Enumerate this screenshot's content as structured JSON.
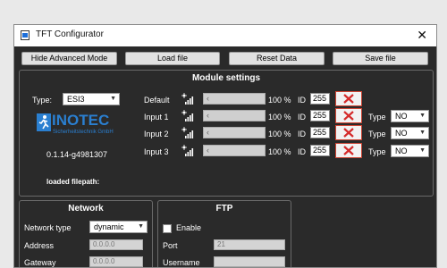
{
  "window": {
    "title": "TFT Configurator",
    "close": "✕"
  },
  "toolbar": {
    "hide_advanced": "Hide Advanced Mode",
    "load_file": "Load file",
    "reset_data": "Reset Data",
    "save_file": "Save file"
  },
  "module_settings": {
    "title": "Module settings",
    "type_label": "Type:",
    "type_value": "ESI3",
    "logo": {
      "word": "INOTEC",
      "sub": "Sicherheitstechnik GmbH"
    },
    "version": "0.1.14-g4981307",
    "loaded_filepath_label": "loaded filepath:",
    "rows": [
      {
        "label": "Default",
        "percent": "100 %",
        "id_label": "ID",
        "id_value": "255",
        "level": 1.0
      },
      {
        "label": "Input 1",
        "percent": "100 %",
        "id_label": "ID",
        "id_value": "255",
        "type_label": "Type",
        "type_value": "NO",
        "level": 1.0
      },
      {
        "label": "Input 2",
        "percent": "100 %",
        "id_label": "ID",
        "id_value": "255",
        "type_label": "Type",
        "type_value": "NO",
        "level": 1.0
      },
      {
        "label": "Input 3",
        "percent": "100 %",
        "id_label": "ID",
        "id_value": "255",
        "type_label": "Type",
        "type_value": "NO",
        "level": 1.0
      }
    ]
  },
  "network": {
    "title": "Network",
    "network_type_label": "Network type",
    "network_type_value": "dynamic",
    "address_label": "Address",
    "address_value": "0.0.0.0",
    "gateway_label": "Gateway",
    "gateway_value": "0.0.0.0"
  },
  "ftp": {
    "title": "FTP",
    "enable_label": "Enable",
    "enabled": false,
    "port_label": "Port",
    "port_value": "21",
    "username_label": "Username",
    "username_value": ""
  },
  "colors": {
    "background": "#2a2a2a",
    "delete_red": "#d42a2a",
    "logo_blue": "#2a7fd0"
  },
  "icons": {
    "app": "app-window-icon",
    "close": "close-icon",
    "delete": "delete-x-icon",
    "brightness": "brightness-bars-icon",
    "dropdown": "chevron-down-icon"
  }
}
